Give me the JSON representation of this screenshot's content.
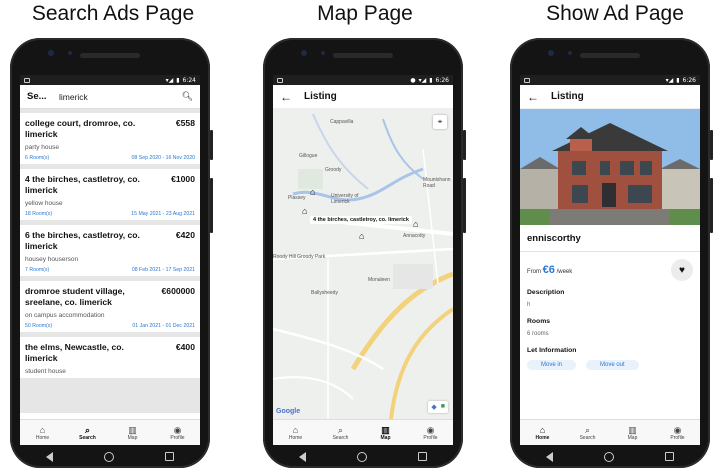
{
  "captions": [
    "Search Ads Page",
    "Map Page",
    "Show Ad Page"
  ],
  "status": {
    "time1": "6:24",
    "time2": "6:26",
    "time3": "6:26"
  },
  "search_page": {
    "title": "Se...",
    "query": "limerick",
    "search_icon": "search-icon",
    "cards": [
      {
        "title": "college court, dromroe, co. limerick",
        "price": "€558",
        "desc": "party house",
        "rooms": "6 Room(s)",
        "dates": "08 Sep 2020 - 16 Nov 2020"
      },
      {
        "title": "4 the birches, castletroy, co. limerick",
        "price": "€1000",
        "desc": "yellow house",
        "rooms": "18 Room(s)",
        "dates": "15 May 2021 - 23 Aug 2021"
      },
      {
        "title": "6 the birches, castletroy, co. limerick",
        "price": "€420",
        "desc": "housey houserson",
        "rooms": "7 Room(s)",
        "dates": "08 Feb 2021 - 17 Sep 2021"
      },
      {
        "title": "dromroe student village, sreelane, co. limerick",
        "price": "€600000",
        "desc": "on campus accommodation",
        "rooms": "50 Room(s)",
        "dates": "01 Jan 2021 - 01 Dec 2021"
      },
      {
        "title": "the elms, Newcastle, co. limerick",
        "price": "€400",
        "desc": "student house",
        "rooms": "",
        "dates": ""
      }
    ]
  },
  "map_page": {
    "title": "Listing",
    "chip": "4 the birches, castletroy, co. limerick",
    "labels": {
      "cappavilla": "Cappavilla",
      "gillogue": "Gillogue",
      "groody": "Groody",
      "mountshannon": "Mountshann Road",
      "plassey": "Plassey",
      "university": "University of Limerick",
      "annacotty": "Annacotty",
      "dooradoyle": "Roody Hill Groody Park",
      "monaleen": "Monaleen",
      "ballysheedy": "Ballysheedy"
    },
    "google": "Google"
  },
  "show_page": {
    "title": "Listing",
    "ad_title": "enniscorthy",
    "price_prefix": "From",
    "price": "€6",
    "price_suffix": "/week",
    "description_label": "Description",
    "description_value": "h",
    "rooms_label": "Rooms",
    "rooms_value": "6 rooms",
    "let_label": "Let Information",
    "chip1": "Move in",
    "chip2": "Move out"
  },
  "bottom_nav": {
    "home": "Home",
    "search": "Search",
    "map": "Map",
    "profile": "Profile"
  },
  "colors": {
    "accent": "#2979d6",
    "statusbar": "#1f1f1f",
    "listbg": "#e6e6e6"
  }
}
